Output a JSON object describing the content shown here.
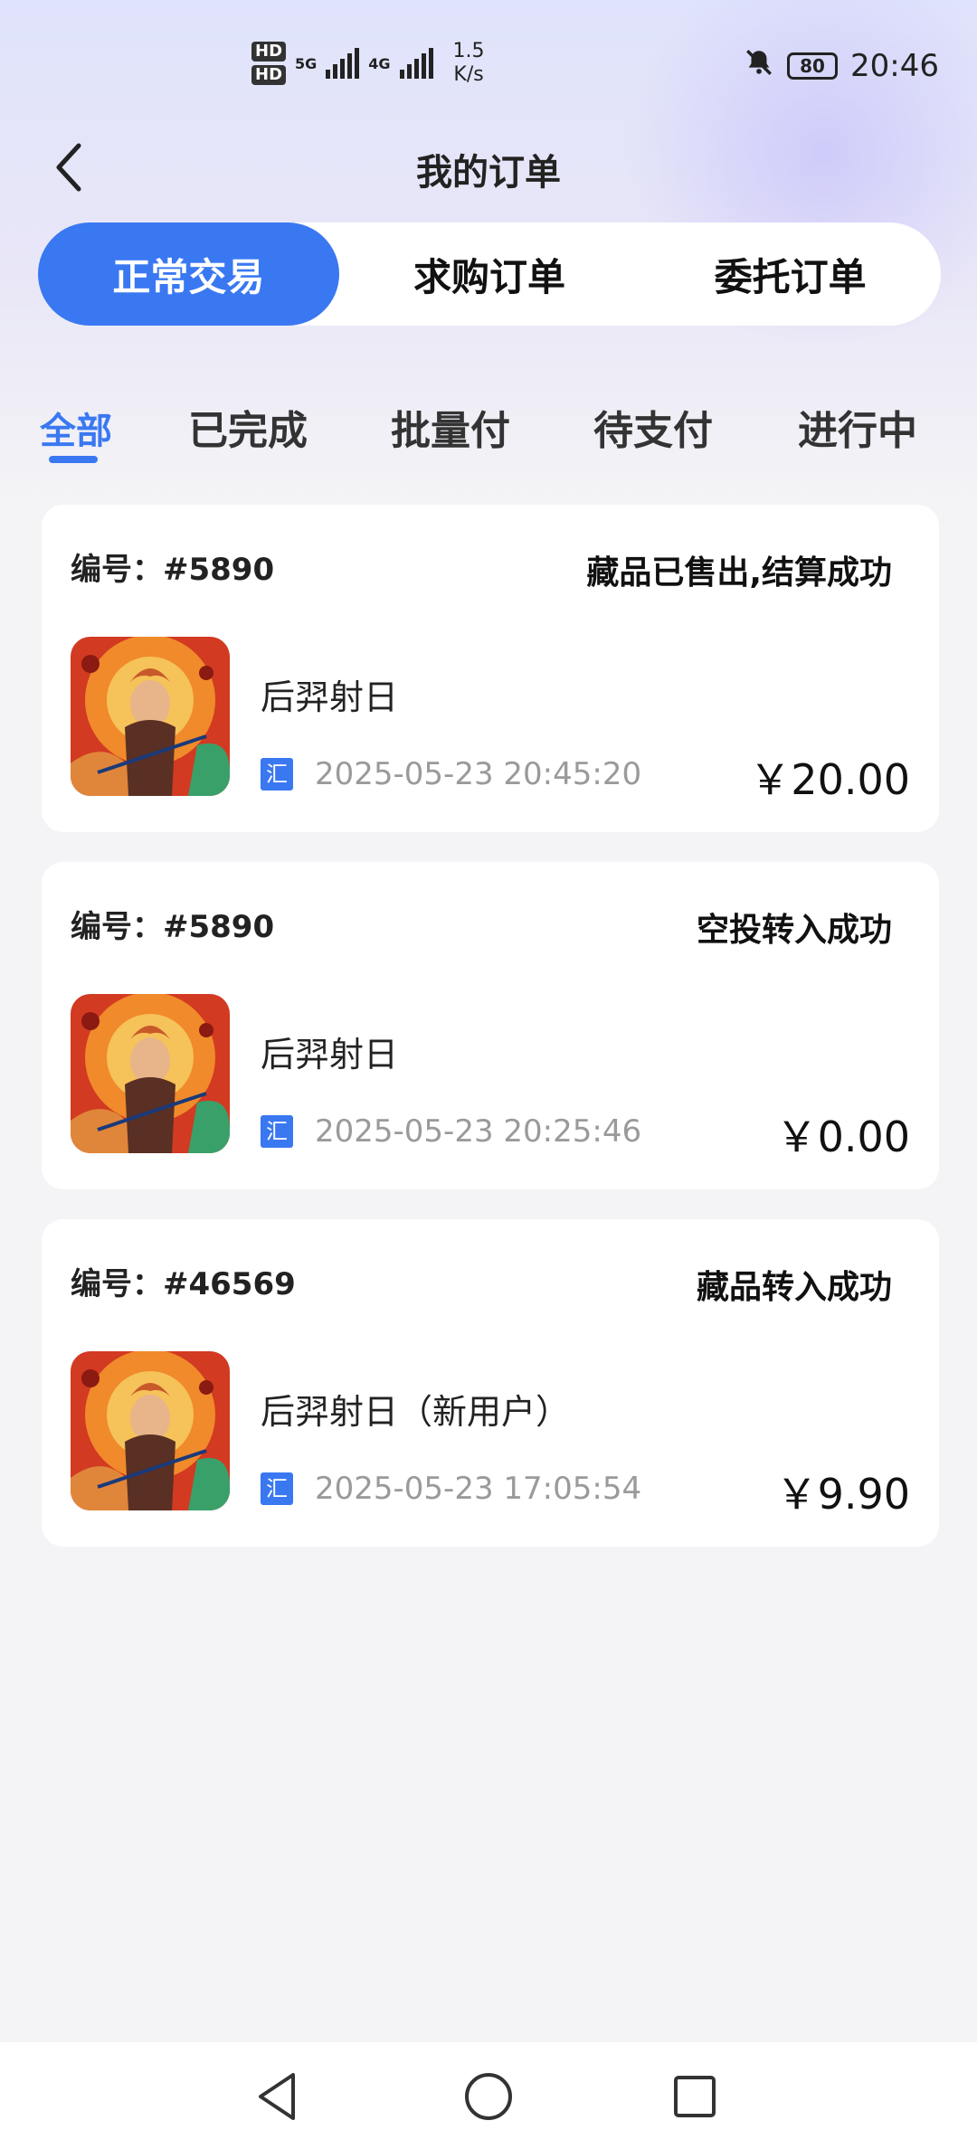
{
  "status_bar": {
    "hd1": "HD",
    "hd2": "HD",
    "sig1": "5G",
    "sig2": "4G",
    "speed_value": "1.5",
    "speed_unit": "K/s",
    "battery": "80",
    "time": "20:46"
  },
  "header": {
    "title": "我的订单",
    "back_icon": "chevron-left-icon"
  },
  "segments": [
    {
      "label": "正常交易",
      "active": true
    },
    {
      "label": "求购订单",
      "active": false
    },
    {
      "label": "委托订单",
      "active": false
    }
  ],
  "status_tabs": [
    {
      "label": "全部",
      "active": true
    },
    {
      "label": "已完成",
      "active": false
    },
    {
      "label": "批量付",
      "active": false
    },
    {
      "label": "待支付",
      "active": false
    },
    {
      "label": "进行中",
      "active": false
    }
  ],
  "orders": [
    {
      "number": "编号：#5890",
      "status": "藏品已售出,结算成功",
      "name": "后羿射日",
      "badge": "汇",
      "time": "2025-05-23 20:45:20",
      "price": "￥20.00"
    },
    {
      "number": "编号：#5890",
      "status": "空投转入成功",
      "name": "后羿射日",
      "badge": "汇",
      "time": "2025-05-23 20:25:46",
      "price": "￥0.00"
    },
    {
      "number": "编号：#46569",
      "status": "藏品转入成功",
      "name": "后羿射日（新用户）",
      "badge": "汇",
      "time": "2025-05-23 17:05:54",
      "price": "￥9.90"
    }
  ],
  "colors": {
    "accent": "#3a78f2",
    "background": "#f4f4f6",
    "card": "#ffffff"
  },
  "nav": {
    "back": "triangle-back-icon",
    "home": "circle-home-icon",
    "recents": "square-recents-icon"
  }
}
